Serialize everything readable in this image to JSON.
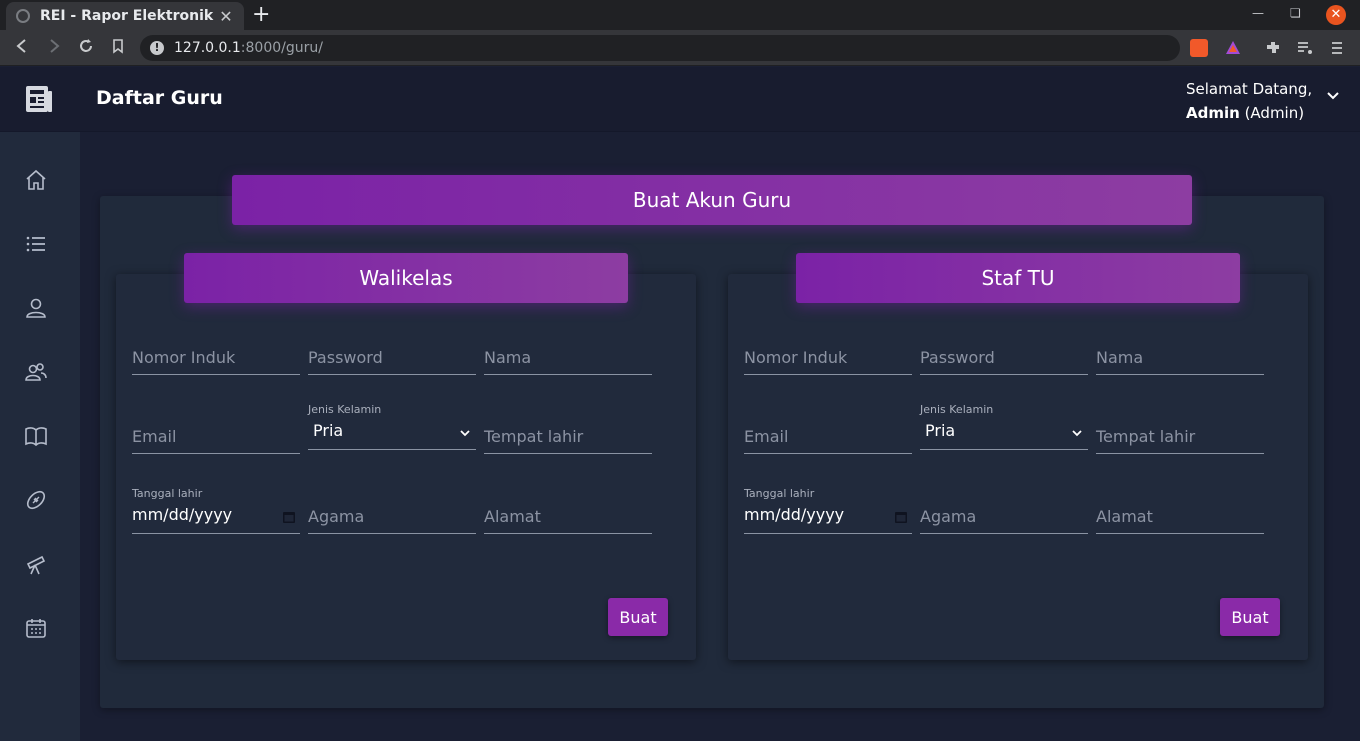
{
  "browser": {
    "tab_title": "REI - Rapor Elektronik",
    "tab_close": "✕",
    "new_tab": "+",
    "url_host": "127.0.0.1",
    "url_rest": ":8000/guru/"
  },
  "header": {
    "page_title": "Daftar Guru",
    "welcome_line1": "Selamat Datang,",
    "welcome_name": "Admin",
    "welcome_role": "(Admin)"
  },
  "sidebar": {
    "items": [
      {
        "icon": "home-icon"
      },
      {
        "icon": "list-icon"
      },
      {
        "icon": "user-icon"
      },
      {
        "icon": "users-icon"
      },
      {
        "icon": "book-icon"
      },
      {
        "icon": "football-icon"
      },
      {
        "icon": "telescope-icon"
      },
      {
        "icon": "calendar-icon"
      }
    ]
  },
  "main": {
    "card_title": "Buat Akun Guru",
    "forms": [
      {
        "title": "Walikelas",
        "nomor_induk": "Nomor Induk",
        "password": "Password",
        "nama": "Nama",
        "email": "Email",
        "jenis_kelamin_label": "Jenis Kelamin",
        "jenis_kelamin_value": "Pria",
        "tempat_lahir": "Tempat lahir",
        "tanggal_lahir_label": "Tanggal lahir",
        "tanggal_lahir_value": "mm/dd/yyyy",
        "agama": "Agama",
        "alamat": "Alamat",
        "submit": "Buat"
      },
      {
        "title": "Staf TU",
        "nomor_induk": "Nomor Induk",
        "password": "Password",
        "nama": "Nama",
        "email": "Email",
        "jenis_kelamin_label": "Jenis Kelamin",
        "jenis_kelamin_value": "Pria",
        "tempat_lahir": "Tempat lahir",
        "tanggal_lahir_label": "Tanggal lahir",
        "tanggal_lahir_value": "mm/dd/yyyy",
        "agama": "Agama",
        "alamat": "Alamat",
        "submit": "Buat"
      }
    ]
  },
  "colors": {
    "accent": "#8a2aa8",
    "sidebar": "#212a3c",
    "topbar": "#181c2f"
  }
}
